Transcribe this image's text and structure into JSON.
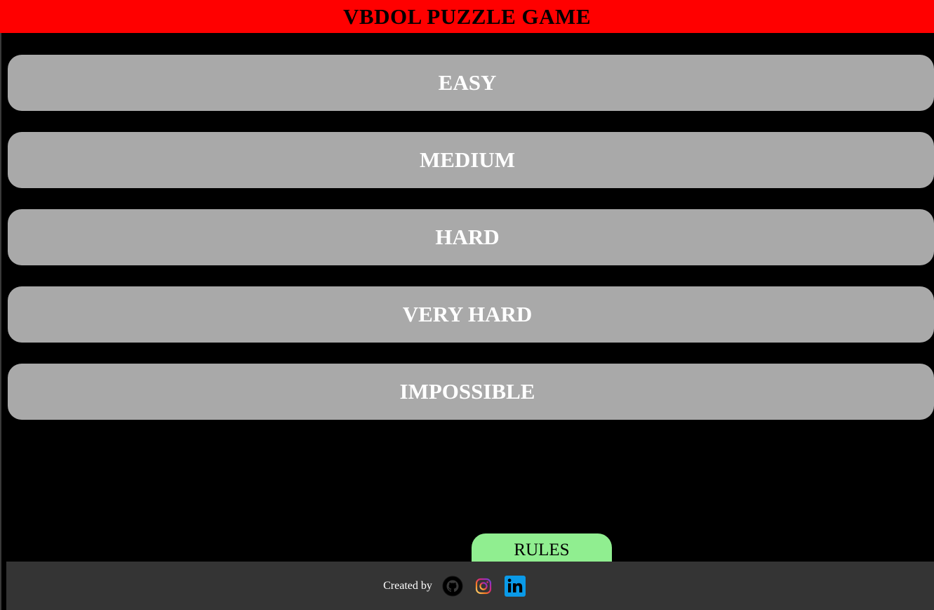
{
  "header": {
    "title": "VBDOL PUZZLE GAME"
  },
  "levels": [
    {
      "label": "EASY"
    },
    {
      "label": "MEDIUM"
    },
    {
      "label": "HARD"
    },
    {
      "label": "VERY HARD"
    },
    {
      "label": "IMPOSSIBLE"
    }
  ],
  "rules": {
    "label": "RULES"
  },
  "footer": {
    "created_by": "Created by",
    "links": [
      {
        "icon": "github-icon"
      },
      {
        "icon": "instagram-icon"
      },
      {
        "icon": "linkedin-icon"
      }
    ]
  },
  "colors": {
    "header_bg": "#ff0000",
    "button_bg": "#a9a9a9",
    "rules_bg": "#90ee90",
    "footer_bg": "#343434",
    "linkedin": "#0a9ae8"
  }
}
